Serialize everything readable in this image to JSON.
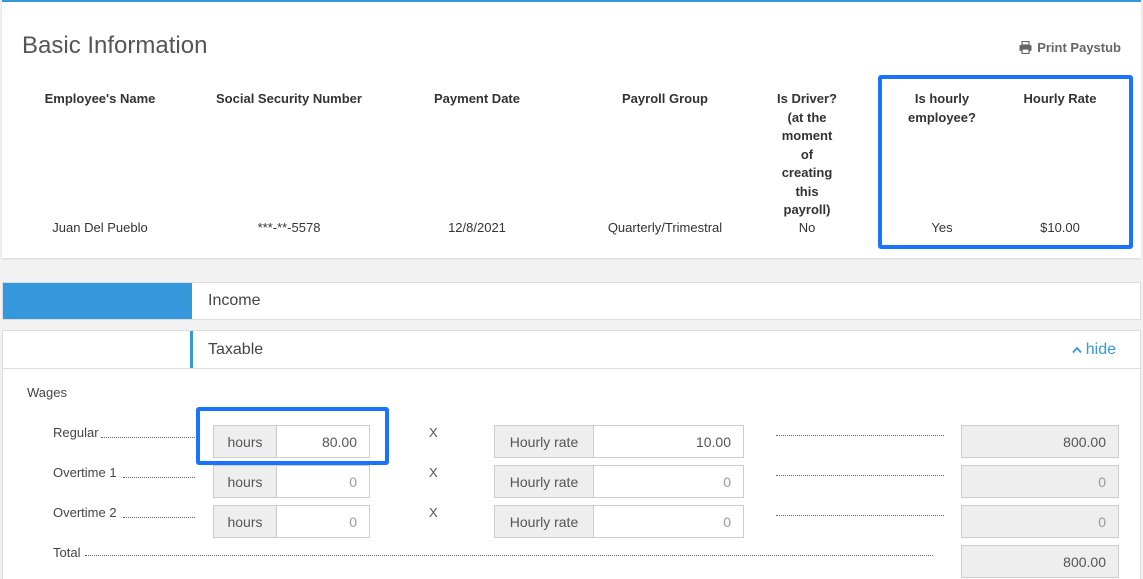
{
  "basic_info": {
    "title": "Basic Information",
    "print_label": "Print Paystub",
    "columns": {
      "employee_name": {
        "header": "Employee's Name",
        "value": "Juan Del Pueblo"
      },
      "ssn": {
        "header": "Social Security Number",
        "value": "***-**-5578"
      },
      "payment_date": {
        "header": "Payment Date",
        "value": "12/8/2021"
      },
      "payroll_group": {
        "header": "Payroll Group",
        "value": "Quarterly/Trimestral"
      },
      "is_driver": {
        "header_lines": [
          "Is Driver?",
          "(at the",
          "moment",
          "of",
          "creating",
          "this",
          "payroll)"
        ],
        "value": "No"
      },
      "is_hourly": {
        "header_lines": [
          "Is hourly",
          "employee?"
        ],
        "value": "Yes"
      },
      "hourly_rate": {
        "header": "Hourly Rate",
        "value": "$10.00"
      }
    }
  },
  "income": {
    "label": "Income",
    "taxable": {
      "label": "Taxable",
      "hide_label": "hide"
    },
    "wages": {
      "title": "Wages",
      "rows": [
        {
          "label": "Regular",
          "hours_addon": "hours",
          "hours": "80.00",
          "times": "X",
          "rate_addon": "Hourly rate",
          "rate": "10.00",
          "total": "800.00"
        },
        {
          "label": "Overtime 1",
          "hours_addon": "hours",
          "hours": "0",
          "times": "X",
          "rate_addon": "Hourly rate",
          "rate": "0",
          "total": "0"
        },
        {
          "label": "Overtime 2",
          "hours_addon": "hours",
          "hours": "0",
          "times": "X",
          "rate_addon": "Hourly rate",
          "rate": "0",
          "total": "0"
        }
      ],
      "total_label": "Total",
      "total_value": "800.00"
    }
  },
  "colors": {
    "accent": "#3498db",
    "highlight": "#1a73ff"
  }
}
